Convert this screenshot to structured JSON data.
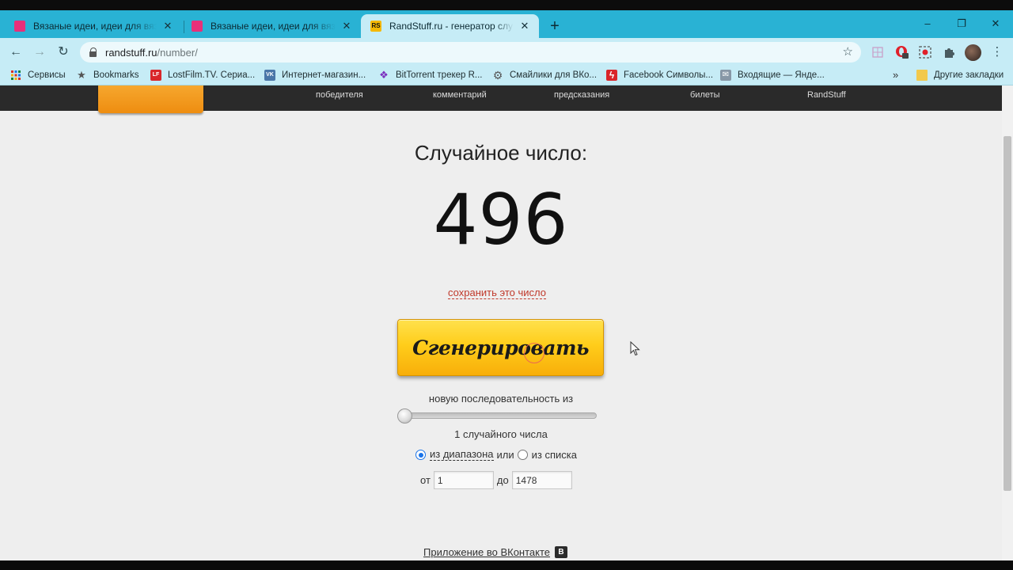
{
  "browser": {
    "tabs": [
      {
        "title": "Вязаные идеи, идеи для вязания",
        "favicon_color": "#e8307a",
        "active": false
      },
      {
        "title": "Вязаные идеи, идеи для вязания",
        "favicon_color": "#e8307a",
        "active": false
      },
      {
        "title": "RandStuff.ru - генератор случайных чисел",
        "favicon_color": "#f5b800",
        "favicon_text": "RS",
        "active": true
      }
    ],
    "new_tab_label": "+",
    "window_controls": {
      "minimize": "–",
      "restore": "❐",
      "close": "✕"
    },
    "nav": {
      "back": "←",
      "forward": "→",
      "reload": "↻"
    },
    "url_host": "randstuff.ru",
    "url_path": "/number/",
    "bookmark_star": "☆",
    "bookmarks": [
      {
        "label": "Сервисы",
        "icon": "apps-grid-icon"
      },
      {
        "label": "Bookmarks",
        "icon": "star-icon"
      },
      {
        "label": "LostFilm.TV. Сериа...",
        "icon": "lostfilm-icon",
        "color": "#d9262a",
        "glyph": "LF"
      },
      {
        "label": "Интернет-магазин...",
        "icon": "vk-icon",
        "color": "#4a76a8",
        "glyph": "VK"
      },
      {
        "label": "BitTorrent трекер R...",
        "icon": "rutracker-icon",
        "color": "#7b2fbe",
        "glyph": "❖"
      },
      {
        "label": "Смайлики для ВКо...",
        "icon": "gear-icon",
        "color": "#555555",
        "glyph": "⚙"
      },
      {
        "label": "Facebook Символы...",
        "icon": "lightning-icon",
        "color": "#d9262a",
        "glyph": "ϟ"
      },
      {
        "label": "Входящие — Янде...",
        "icon": "mail-icon",
        "color": "#6a7a8a",
        "glyph": "✉"
      }
    ],
    "bookmarks_more": "»",
    "other_bookmarks": "Другие закладки"
  },
  "site_nav": [
    "победителя",
    "комментарий",
    "предсказания",
    "билеты",
    "RandStuff"
  ],
  "main": {
    "heading": "Случайное число:",
    "number": "496",
    "save_link": "сохранить это число",
    "generate_button": "Сгенерировать",
    "sequence_text": "новую последовательность из",
    "slider_fraction": 0,
    "count_text": "1 случайного числа",
    "mode_range_label": "из диапазона",
    "mode_or": "или",
    "mode_list_label": "из списка",
    "mode_selected": "range",
    "from_label": "от",
    "from_value": "1",
    "to_label": "до",
    "to_value": "1478",
    "vk_app_link": "Приложение во ВКонтакте",
    "vk_badge": "В"
  },
  "colors": {
    "tabstrip": "#29b2d4",
    "toolbar": "#c6ecf6",
    "site_nav": "#2a2a2a",
    "accent_orange": "#ee8d10",
    "button_yellow": "#ffcd1a",
    "save_link": "#c0392b"
  }
}
